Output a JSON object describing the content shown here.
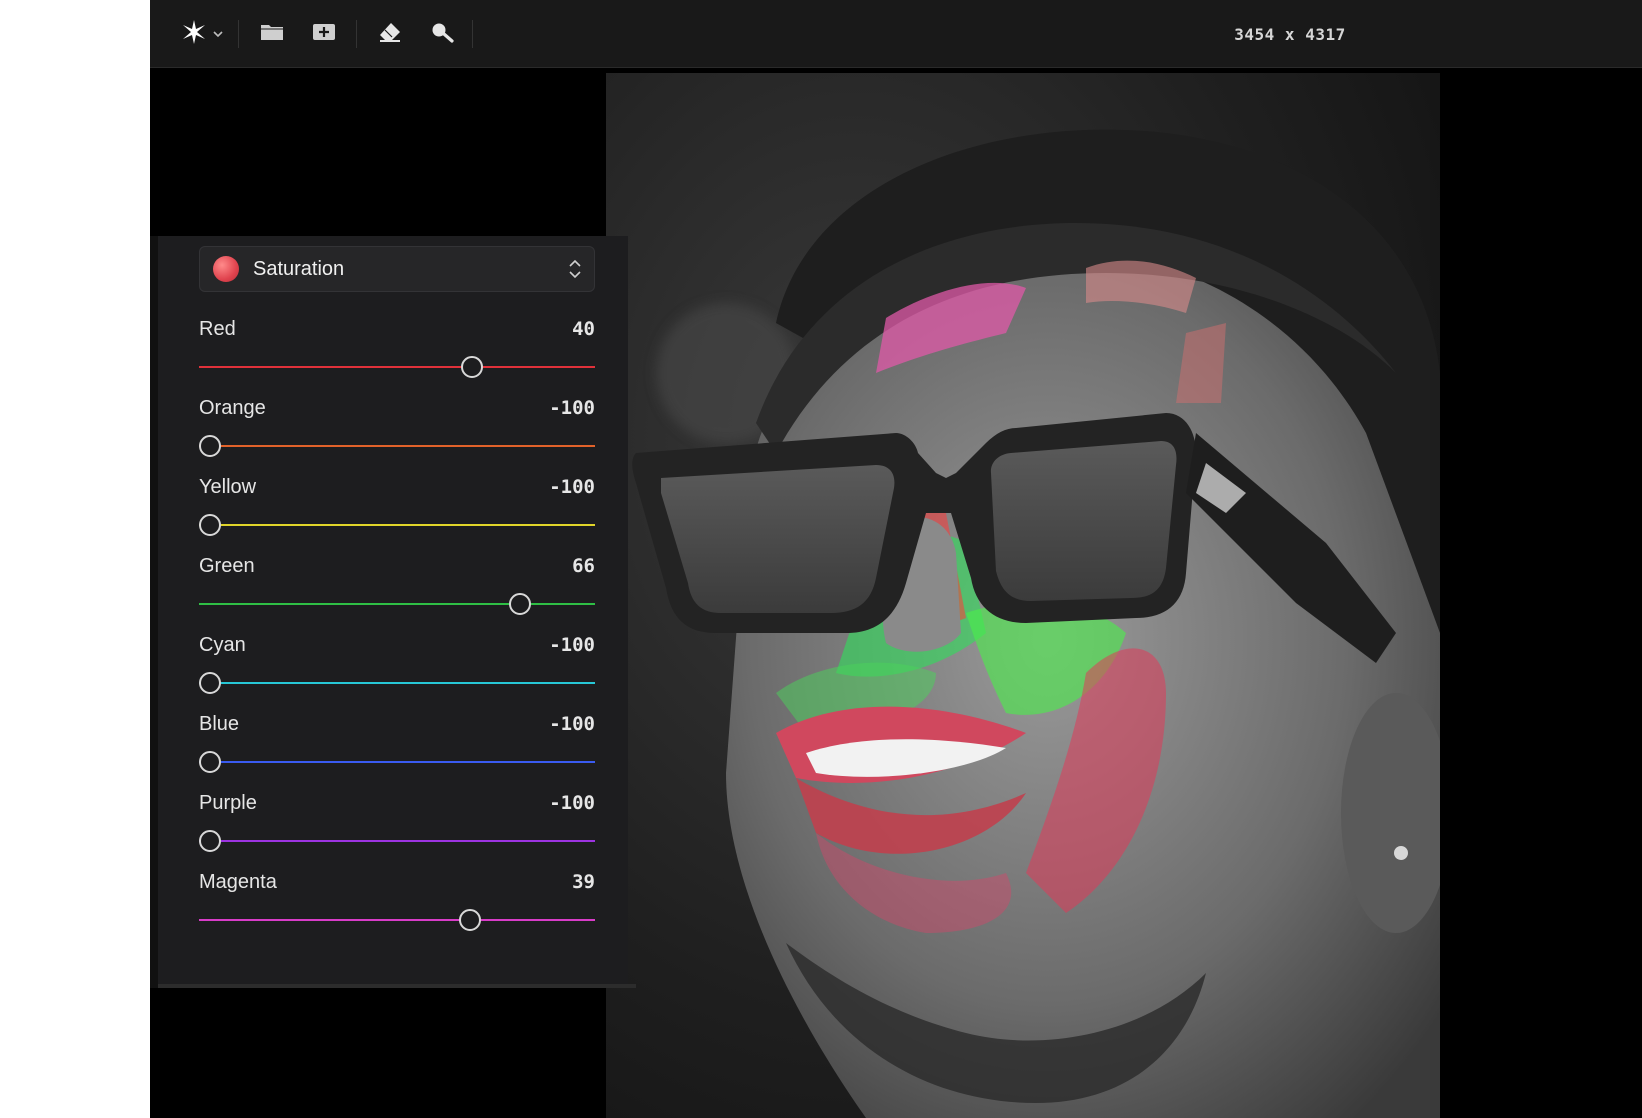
{
  "toolbar": {
    "tools": [
      {
        "icon": "sparkle-icon"
      },
      {
        "icon": "chevron-down-icon"
      },
      {
        "icon": "folder-icon"
      },
      {
        "icon": "add-image-icon"
      },
      {
        "icon": "eraser-icon"
      },
      {
        "icon": "zoom-icon"
      }
    ],
    "dimensions": "3454 x 4317"
  },
  "panel": {
    "mode": {
      "label": "Saturation",
      "color": "#e0434e"
    },
    "sliders": [
      {
        "label": "Red",
        "value": "40",
        "level": 0.7,
        "color": "#e0313a"
      },
      {
        "label": "Orange",
        "value": "-100",
        "level": 0.0,
        "color": "#e2622a"
      },
      {
        "label": "Yellow",
        "value": "-100",
        "level": 0.0,
        "color": "#e0d42a"
      },
      {
        "label": "Green",
        "value": "66",
        "level": 0.83,
        "color": "#2fbf45"
      },
      {
        "label": "Cyan",
        "value": "-100",
        "level": 0.0,
        "color": "#27c7d6"
      },
      {
        "label": "Blue",
        "value": "-100",
        "level": 0.0,
        "color": "#3a5bf0"
      },
      {
        "label": "Purple",
        "value": "-100",
        "level": 0.0,
        "color": "#9c33e0"
      },
      {
        "label": "Magenta",
        "value": "39",
        "level": 0.695,
        "color": "#d83cc8"
      }
    ]
  }
}
